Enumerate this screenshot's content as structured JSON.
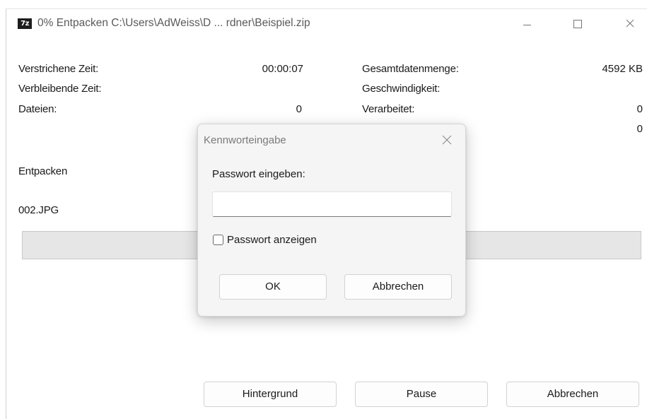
{
  "window": {
    "app_icon_text": "7z",
    "title": "0% Entpacken C:\\Users\\AdWeiss\\D ... rdner\\Beispiel.zip"
  },
  "stats": {
    "left": [
      {
        "label": "Verstrichene Zeit:",
        "value": "00:00:07"
      },
      {
        "label": "Verbleibende Zeit:",
        "value": ""
      },
      {
        "label": "Dateien:",
        "value": "0"
      }
    ],
    "right": [
      {
        "label": "Gesamtdatenmenge:",
        "value": "4592 KB"
      },
      {
        "label": "Geschwindigkeit:",
        "value": ""
      },
      {
        "label": "Verarbeitet:",
        "value": "0"
      },
      {
        "label": "",
        "value": "0"
      }
    ]
  },
  "operation": "Entpacken",
  "current_file": "002.JPG",
  "progress_percent": 0,
  "buttons": {
    "background": "Hintergrund",
    "pause": "Pause",
    "cancel": "Abbrechen"
  },
  "dialog": {
    "title": "Kennworteingabe",
    "prompt": "Passwort eingeben:",
    "password_value": "",
    "show_password_label": "Passwort anzeigen",
    "show_password_checked": false,
    "ok_label": "OK",
    "cancel_label": "Abbrechen"
  },
  "icons": [
    "7zip-app-icon",
    "minimize-icon",
    "maximize-icon",
    "close-icon",
    "dialog-close-icon"
  ],
  "colors": {
    "window_bg": "#ffffff",
    "dialog_bg": "#f5f5f5",
    "progress_track": "#e6e6e6",
    "title_text": "#5a5a5a"
  }
}
